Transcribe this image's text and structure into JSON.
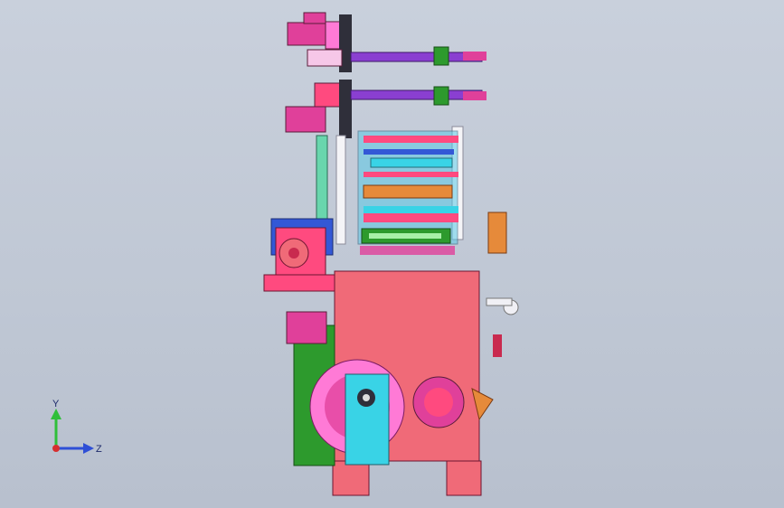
{
  "viewport": {
    "background_top": "#c9d0dc",
    "background_bottom": "#b8c0ce"
  },
  "triad": {
    "y_label": "Y",
    "z_label": "Z",
    "y_color": "#2fbf3a",
    "z_color": "#2f4fd6",
    "x_color": "#d62f2f"
  },
  "model": {
    "name": "",
    "palette": {
      "frame_red": "#f06a78",
      "magenta": "#e0409a",
      "purple": "#8a3fd1",
      "green": "#2d9a2d",
      "cyan": "#39d3e6",
      "blue": "#3358d6",
      "orange": "#e68a3a",
      "dark": "#2f2f3a",
      "pink": "#ff7ad6"
    }
  }
}
